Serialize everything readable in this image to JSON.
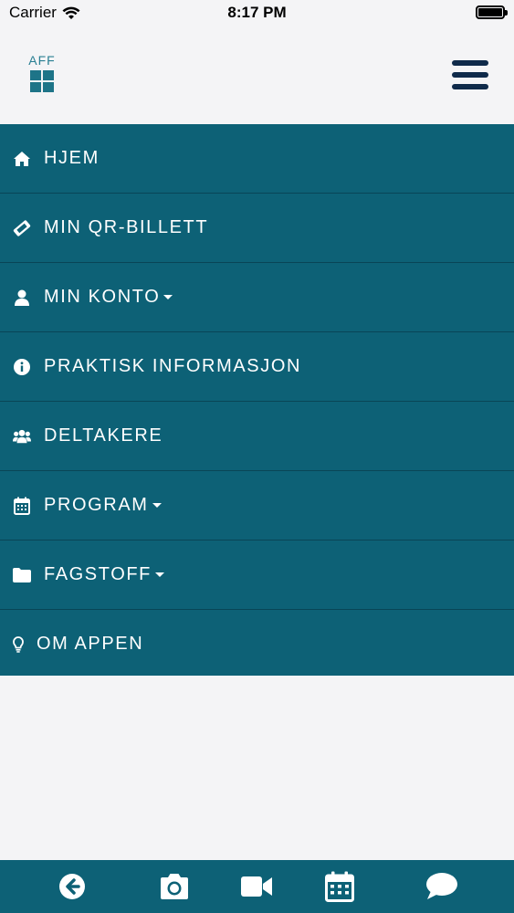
{
  "status_bar": {
    "carrier": "Carrier",
    "time": "8:17 PM"
  },
  "header": {
    "logo_text": "AFF"
  },
  "menu": {
    "items": [
      {
        "label": "HJEM",
        "icon": "home-icon",
        "dropdown": false
      },
      {
        "label": "MIN QR-BILLETT",
        "icon": "ticket-icon",
        "dropdown": false
      },
      {
        "label": "MIN KONTO",
        "icon": "user-icon",
        "dropdown": true
      },
      {
        "label": "PRAKTISK INFORMASJON",
        "icon": "info-icon",
        "dropdown": false
      },
      {
        "label": "DELTAKERE",
        "icon": "users-icon",
        "dropdown": false
      },
      {
        "label": "PROGRAM",
        "icon": "calendar-icon",
        "dropdown": true
      },
      {
        "label": "FAGSTOFF",
        "icon": "folder-icon",
        "dropdown": true
      },
      {
        "label": "OM APPEN",
        "icon": "lightbulb-icon",
        "dropdown": false
      }
    ]
  },
  "bottom_nav": {
    "tabs": [
      {
        "icon": "back-arrow-icon"
      },
      {
        "icon": "camera-icon"
      },
      {
        "icon": "video-icon"
      },
      {
        "icon": "calendar-icon"
      },
      {
        "icon": "chat-icon"
      }
    ]
  },
  "colors": {
    "menu_bg": "#0d6176",
    "header_bg": "#f4f4f6",
    "hamburger": "#0f2a4a",
    "menu_text": "#ffffff"
  }
}
